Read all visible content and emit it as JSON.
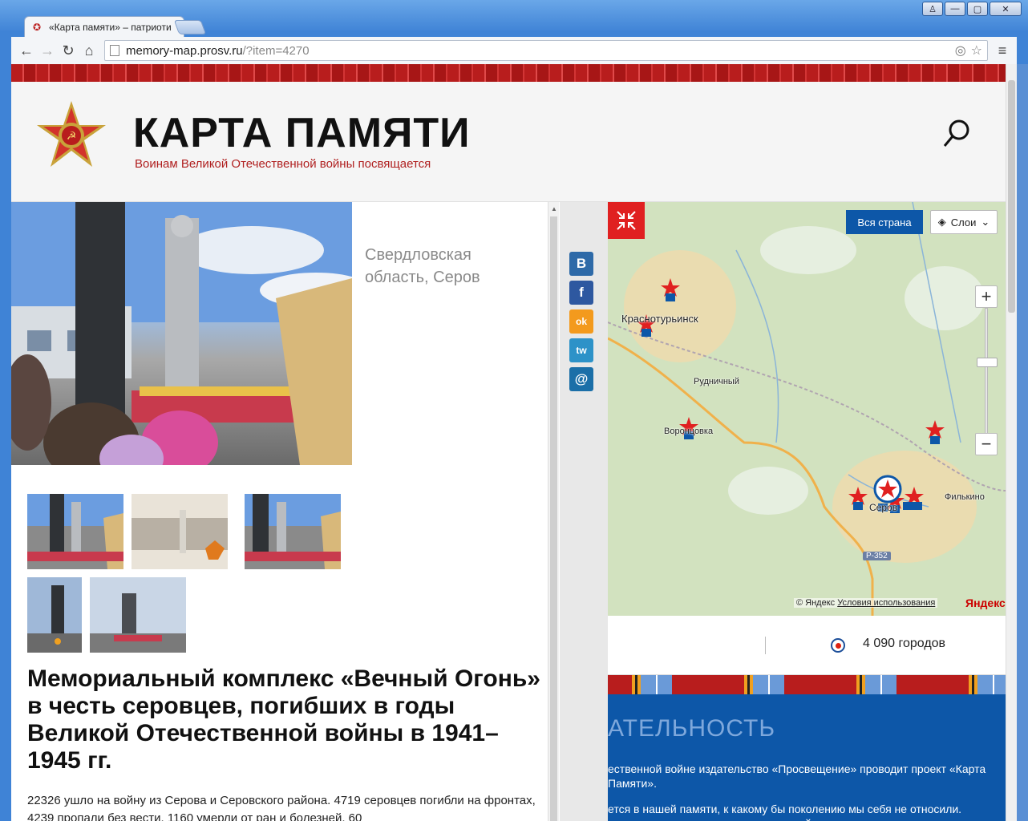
{
  "browser": {
    "tab_title": "«Карта памяти» – патриоти",
    "url_domain": "memory-map.prosv.ru",
    "url_path": "/?item=4270",
    "window_controls": [
      "♙",
      "—",
      "▢",
      "✕"
    ]
  },
  "header": {
    "title": "КАРТА ПАМЯТИ",
    "subtitle": "Воинам Великой Отечественной войны посвящается"
  },
  "memorial": {
    "location_line1": "Свердловская",
    "location_line2": "область, Серов",
    "title": "Мемориальный комплекс «Вечный Огонь» в честь серовцев, погибших в годы Великой Отечественной войны в 1941–1945 гг.",
    "text": "22326 ушло на войну из Серова и Серовского района. 4719 серовцев погибли на фронтах, 4239 пропали без вести, 1160 умерли от ран и болезней, 60"
  },
  "share": {
    "vk": "В",
    "fb": "f",
    "ok": "ok",
    "tw": "tw",
    "mail": "@"
  },
  "map": {
    "btn_country": "Вся страна",
    "btn_layers": "Слои",
    "zoom_in": "+",
    "zoom_out": "−",
    "labels": {
      "krasnoturyinsk": "Краснотурьинск",
      "rudnichny": "Рудничный",
      "vorontsovka": "Воронцовка",
      "serov": "Серов",
      "filkino": "Филькино",
      "road": "Р-352"
    },
    "copyright": "© Яндекс",
    "terms": "Условия использования",
    "brand": "Яндекс"
  },
  "stats": {
    "cities": "4 090 городов"
  },
  "about": {
    "title": "АТЕЛЬНОСТЬ",
    "para1": "ественной войне издательство «Просвещение» проводит проект «Карта Памяти».",
    "para2": "ется в нашей памяти, к какому бы поколению мы себя не относили. кромные могилы на территории нашей страны"
  },
  "colors": {
    "accent_red": "#e02020",
    "brand_blue": "#0d57a8",
    "subtitle_red": "#b02020"
  }
}
